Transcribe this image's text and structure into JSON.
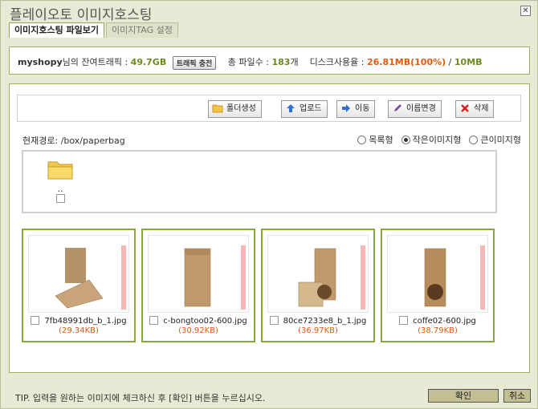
{
  "window": {
    "title": "플레이오토 이미지호스팅",
    "close_glyph": "✕"
  },
  "tabs": [
    {
      "label": "이미지호스팅 파일보기",
      "active": true
    },
    {
      "label": "이미지TAG 설정",
      "active": false
    }
  ],
  "info": {
    "user": "myshopy",
    "remaining_label": "님의 잔여트래픽 :",
    "remaining_value": "49.7GB",
    "charge_button": "트래픽 충전",
    "files_label": "총 파일수 :",
    "files_value": "183",
    "files_unit": "개",
    "disk_label": "디스크사용율 :",
    "disk_used": "26.81MB(100%)",
    "disk_sep": "/",
    "disk_total": "10MB"
  },
  "toolbar": {
    "new_folder": "폴더생성",
    "upload": "업로드",
    "move": "이동",
    "rename": "이름변경",
    "delete": "삭제"
  },
  "path": {
    "label": "현재경로:",
    "value": "/box/paperbag"
  },
  "view_options": [
    {
      "label": "목록형",
      "selected": false
    },
    {
      "label": "작은이미지형",
      "selected": true
    },
    {
      "label": "큰이미지형",
      "selected": false
    }
  ],
  "folders": [
    {
      "label": ".."
    }
  ],
  "files": [
    {
      "name": "7fb48991db_b_1.jpg",
      "size": "(29.34KB)"
    },
    {
      "name": "c-bongtoo02-600.jpg",
      "size": "(30.92KB)"
    },
    {
      "name": "80ce7233e8_b_1.jpg",
      "size": "(36.97KB)"
    },
    {
      "name": "coffe02-600.jpg",
      "size": "(38.79KB)"
    }
  ],
  "footer": {
    "tip": "TIP. 입력을 원하는 이미지에 체크하신 후 [확인] 버튼을 누르십시오.",
    "confirm": "확인",
    "cancel": "취소"
  },
  "colors": {
    "accent_green": "#9db35a",
    "highlight_orange": "#e05a10",
    "button_tan": "#c2bf92"
  }
}
